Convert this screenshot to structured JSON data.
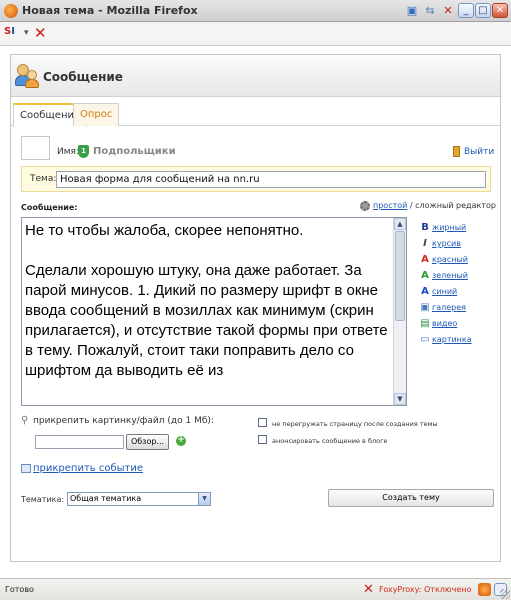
{
  "window": {
    "title": "Новая тема - Mozilla Firefox",
    "min_label": "_",
    "max_label": "□",
    "close_label": "✕"
  },
  "toolbar": {
    "si_s": "S",
    "si_i": "I"
  },
  "panel": {
    "title": "Сообщение"
  },
  "tabs": [
    {
      "label": "Сообщение",
      "active": true
    },
    {
      "label": "Опрос",
      "active": false
    }
  ],
  "user": {
    "name_label": "Имя:",
    "level_badge": "1",
    "username": "Подпольщики",
    "logout_label": "Выйти"
  },
  "subject": {
    "label": "Тема:",
    "value": "Новая форма для сообщений на nn.ru"
  },
  "message": {
    "label": "Сообщение:",
    "mode_simple": "простой",
    "mode_separator": " / ",
    "mode_complex": "сложный редактор",
    "text": "Не то чтобы жалоба, скорее непонятно.\n\nСделали хорошую штуку, она даже работает. За парой минусов. 1. Дикий по размеру шрифт в окне ввода сообщений в мозиллах как минимум (скрин прилагается), и отсутствие такой формы при ответе в тему. Пожалуй, стоит таки поправить дело со шрифтом да выводить её из"
  },
  "format_tools": [
    {
      "icon": "B",
      "label": "жирный",
      "color": "#1d3f8f"
    },
    {
      "icon": "I",
      "label": "курсив",
      "color": "#444444"
    },
    {
      "icon": "A",
      "label": "красный",
      "color": "#d42a1a"
    },
    {
      "icon": "A",
      "label": "зеленый",
      "color": "#2e9a2e"
    },
    {
      "icon": "A",
      "label": "синий",
      "color": "#1f47c8"
    },
    {
      "icon": "▣",
      "label": "галерея",
      "color": "#4a7bc0"
    },
    {
      "icon": "▤",
      "label": "видео",
      "color": "#2b8a3a"
    },
    {
      "icon": "▭",
      "label": "картинка",
      "color": "#4a7bc0"
    }
  ],
  "attachment": {
    "label": "прикрепить картинку/файл (до 1 Мб):",
    "browse_label": "Обзор...",
    "add_icon": "+"
  },
  "options": {
    "no_reload_label": "не перегружать страницу после создания темы",
    "announce_label": "анонсировать сообщение в блоге"
  },
  "event": {
    "label": "прикрепить событие"
  },
  "topic": {
    "label": "Тематика:",
    "selected": "Общая тематика"
  },
  "create_button": "Создать тему",
  "status": {
    "text": "Готово",
    "foxyproxy": "FoxyProxy: Отключено"
  }
}
